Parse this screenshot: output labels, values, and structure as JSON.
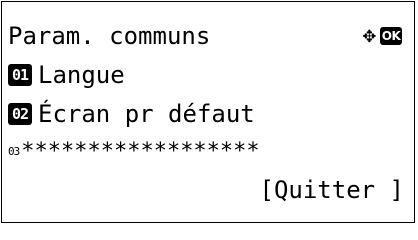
{
  "screen": {
    "title": "Param. communs",
    "nav_icon": "up-down-left-right-arrows-icon",
    "ok_label": "OK"
  },
  "menu": {
    "items": [
      {
        "number": "01",
        "label": "Langue"
      },
      {
        "number": "02",
        "label": "Écran pr défaut"
      }
    ]
  },
  "next_row": {
    "number_hint": "03",
    "mask": "******************"
  },
  "softkey": {
    "label": "[Quitter ]"
  }
}
